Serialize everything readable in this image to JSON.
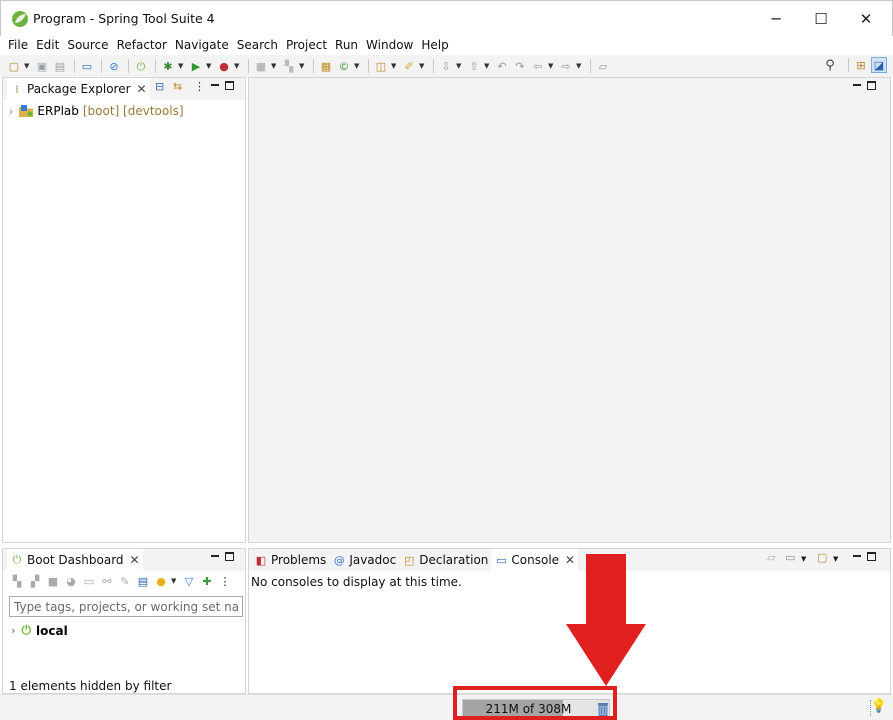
{
  "window": {
    "title": "Program - Spring Tool Suite 4",
    "minimize": "─",
    "maximize": "☐",
    "close": "✕"
  },
  "menu": [
    "File",
    "Edit",
    "Source",
    "Refactor",
    "Navigate",
    "Search",
    "Project",
    "Run",
    "Window",
    "Help"
  ],
  "package_explorer": {
    "tab_label": "Package Explorer",
    "project": {
      "name": "ERPlab",
      "decorations": "[boot] [devtools]"
    }
  },
  "boot_dashboard": {
    "tab_label": "Boot Dashboard",
    "filter_placeholder": "Type tags, projects, or working set names",
    "local_label": "local",
    "hidden_text": "1 elements hidden by filter"
  },
  "bottom_tabs": {
    "problems": "Problems",
    "javadoc": "Javadoc",
    "declaration": "Declaration",
    "console": "Console"
  },
  "console": {
    "message": "No consoles to display at this time."
  },
  "status": {
    "heap_text": "211M of 308M",
    "heap_used_fraction": 0.685
  },
  "colors": {
    "highlight": "#e0201f",
    "spring_green": "#6db33f",
    "tab_bg": "#f3f3f3"
  },
  "icons": {
    "app": "spring-leaf-icon",
    "gc": "trash-icon",
    "tip": "lightbulb-icon"
  }
}
